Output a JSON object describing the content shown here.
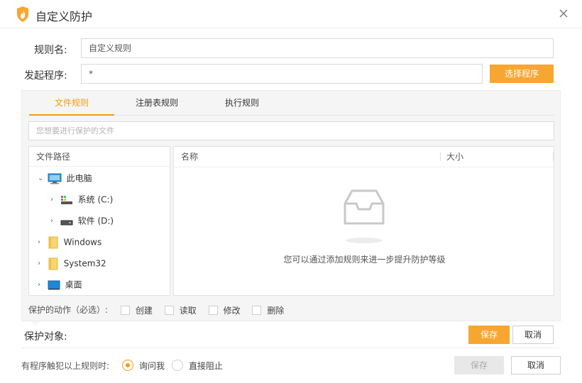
{
  "window": {
    "title": "自定义防护"
  },
  "form": {
    "rule_name_label": "规则名:",
    "rule_name_value": "自定义规则",
    "launcher_label": "发起程序:",
    "launcher_value": "*",
    "select_program_label": "选择程序"
  },
  "tabs": [
    {
      "label": "文件规则",
      "active": true
    },
    {
      "label": "注册表规则",
      "active": false
    },
    {
      "label": "执行规则",
      "active": false
    }
  ],
  "file_search": {
    "placeholder": "您想要进行保护的文件"
  },
  "tree": {
    "header": "文件路径",
    "items": [
      {
        "label": "此电脑",
        "icon": "computer-icon"
      },
      {
        "label": "系统 (C:)",
        "icon": "system-drive-icon"
      },
      {
        "label": "软件 (D:)",
        "icon": "drive-icon"
      },
      {
        "label": "Windows",
        "icon": "folder-icon"
      },
      {
        "label": "System32",
        "icon": "folder-icon"
      },
      {
        "label": "桌面",
        "icon": "desktop-icon"
      }
    ]
  },
  "list": {
    "columns": [
      "名称",
      "大小"
    ],
    "empty_message": "您可以通过添加规则来进一步提升防护等级"
  },
  "actions": {
    "label": "保护的动作（必选）:",
    "options": [
      "创建",
      "读取",
      "修改",
      "删除"
    ]
  },
  "protect_object": {
    "label": "保护对象:",
    "save_label": "保存",
    "cancel_label": "取消"
  },
  "trigger": {
    "label": "有程序触犯以上规则时:",
    "options": [
      {
        "label": "询问我",
        "checked": true
      },
      {
        "label": "直接阻止",
        "checked": false
      }
    ]
  },
  "footer": {
    "save_label": "保存",
    "cancel_label": "取消"
  },
  "colors": {
    "accent": "#f7a630",
    "accent_text": "#f39c12"
  }
}
